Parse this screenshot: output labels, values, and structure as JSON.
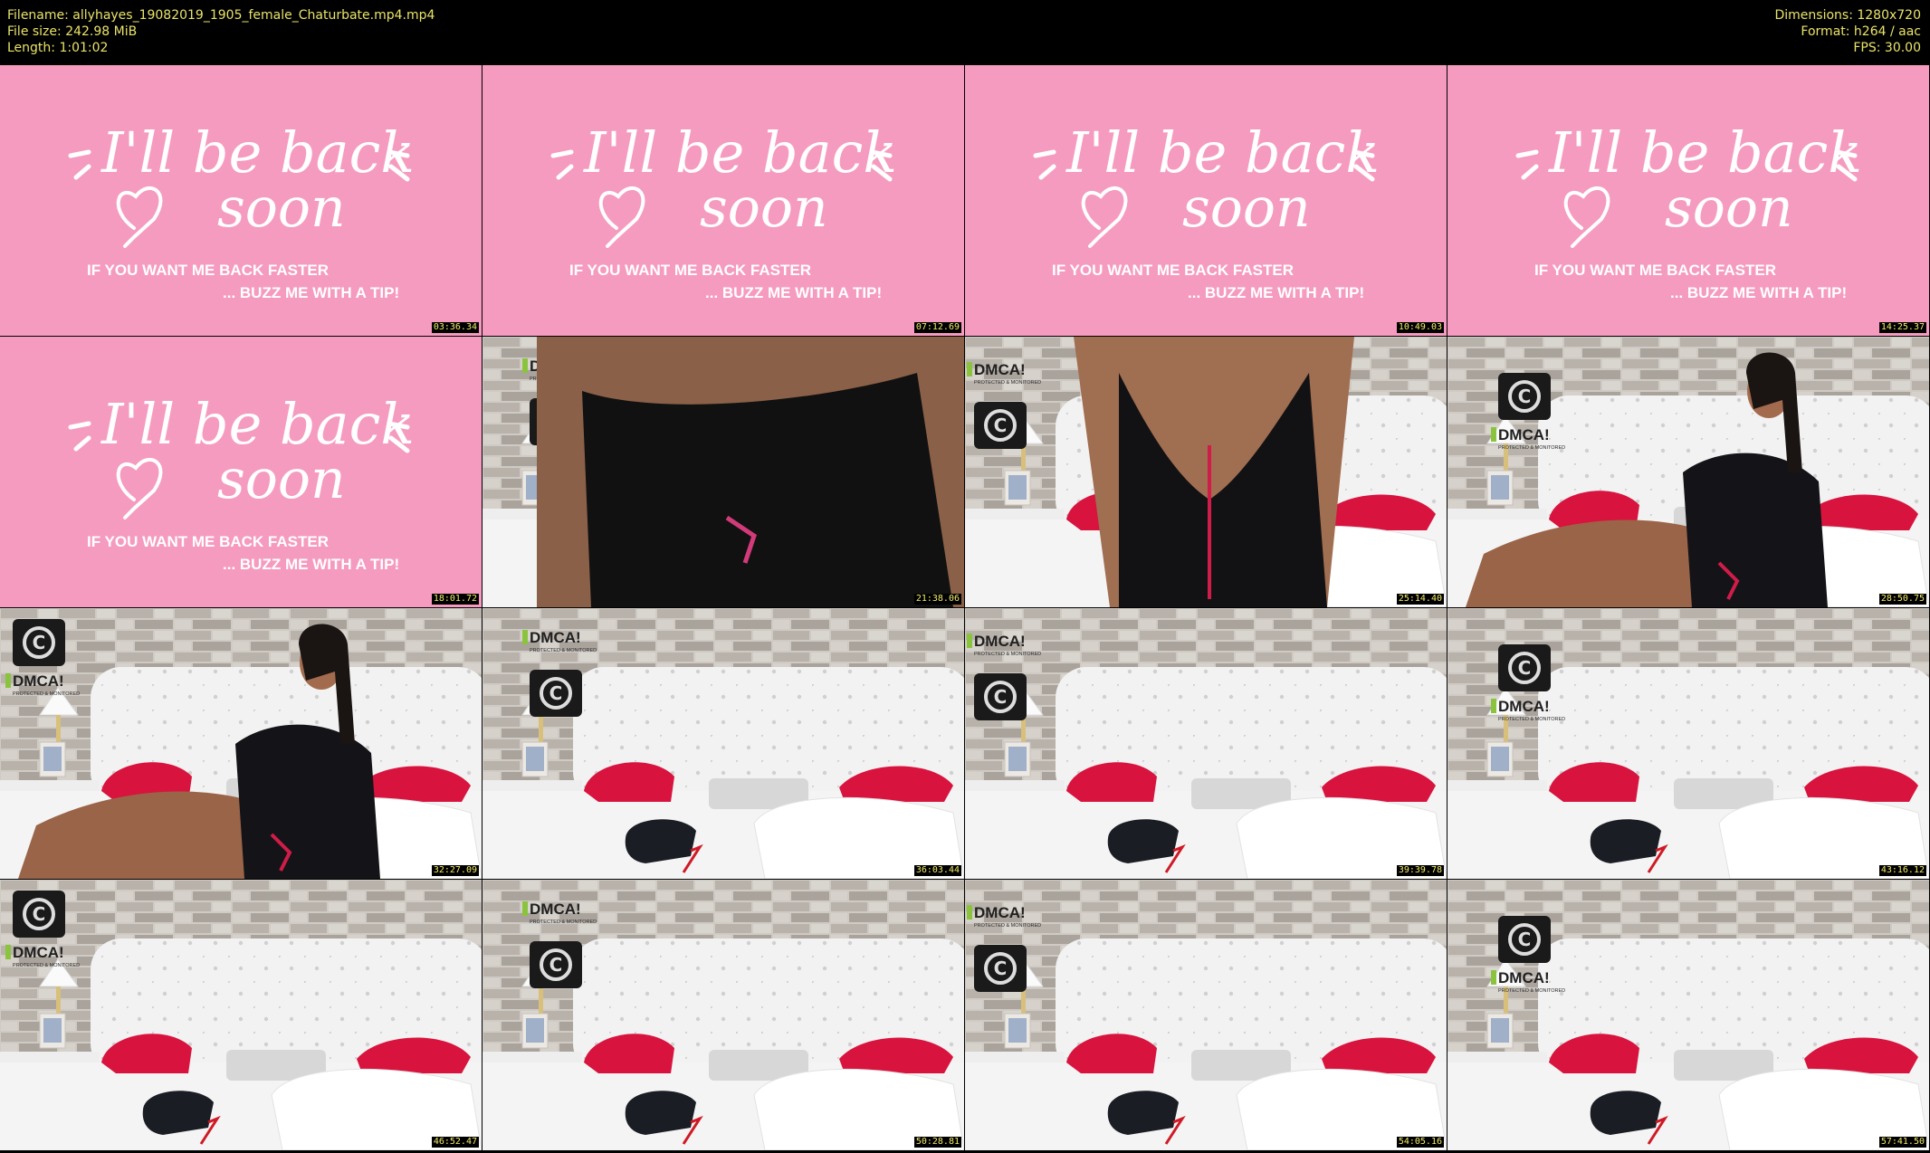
{
  "header": {
    "filename": "Filename: allyhayes_19082019_1905_female_Chaturbate.mp4.mp4",
    "filesize": "File size: 242.98 MiB",
    "length": "Length: 1:01:02",
    "dimensions": "Dimensions: 1280x720",
    "format": "Format: h264 / aac",
    "fps": "FPS: 30.00"
  },
  "brb": {
    "line1": "I'll be back",
    "line2": "soon",
    "sub1": "IF YOU WANT ME BACK FASTER",
    "sub2": "... BUZZ ME WITH A TIP!"
  },
  "watermark": {
    "badge": "DMCA!",
    "badge_sub": "PROTECTED & MONITORED"
  },
  "colors": {
    "pink": "#f59bbf",
    "meta_text": "#e9e36a",
    "red_pillow": "#d8133e"
  },
  "thumbnails": [
    {
      "time": "03:36.34",
      "scene": "brb"
    },
    {
      "time": "07:12.69",
      "scene": "brb"
    },
    {
      "time": "10:49.03",
      "scene": "brb"
    },
    {
      "time": "14:25.37",
      "scene": "brb"
    },
    {
      "time": "18:01.72",
      "scene": "brb"
    },
    {
      "time": "21:38.06",
      "scene": "closeup-waist"
    },
    {
      "time": "25:14.40",
      "scene": "closeup-torso"
    },
    {
      "time": "28:50.75",
      "scene": "model-lounging"
    },
    {
      "time": "32:27.09",
      "scene": "model-lounging"
    },
    {
      "time": "36:03.44",
      "scene": "empty-bed"
    },
    {
      "time": "39:39.78",
      "scene": "empty-bed"
    },
    {
      "time": "43:16.12",
      "scene": "empty-bed"
    },
    {
      "time": "46:52.47",
      "scene": "empty-bed"
    },
    {
      "time": "50:28.81",
      "scene": "empty-bed"
    },
    {
      "time": "54:05.16",
      "scene": "empty-bed"
    },
    {
      "time": "57:41.50",
      "scene": "empty-bed"
    }
  ]
}
